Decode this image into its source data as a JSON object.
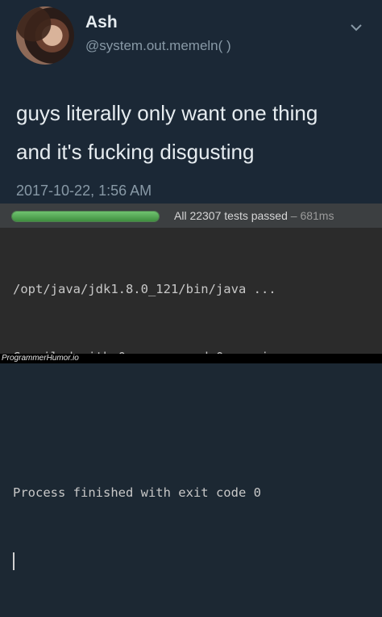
{
  "tweet": {
    "display_name": "Ash",
    "handle": "@system.out.memeln( )",
    "text_lines": [
      "guys literally only want one thing",
      "and it's fucking disgusting"
    ],
    "timestamp": "2017-10-22, 1:56 AM"
  },
  "test_runner": {
    "status": "All 22307 tests passed",
    "separator": "–",
    "duration": "681ms",
    "progress": 1.0,
    "progress_color": "#5cb85c"
  },
  "console": {
    "lines": [
      "/opt/java/jdk1.8.0_121/bin/java ...",
      "Compiled with 0 errors and 0 warnings",
      "",
      "Process finished with exit code 0"
    ]
  },
  "watermark": "ProgrammerHumor.io",
  "colors": {
    "tweet_background": "#1b2836",
    "ide_background": "#2b2b2b",
    "secondary_text": "#8899a6"
  }
}
